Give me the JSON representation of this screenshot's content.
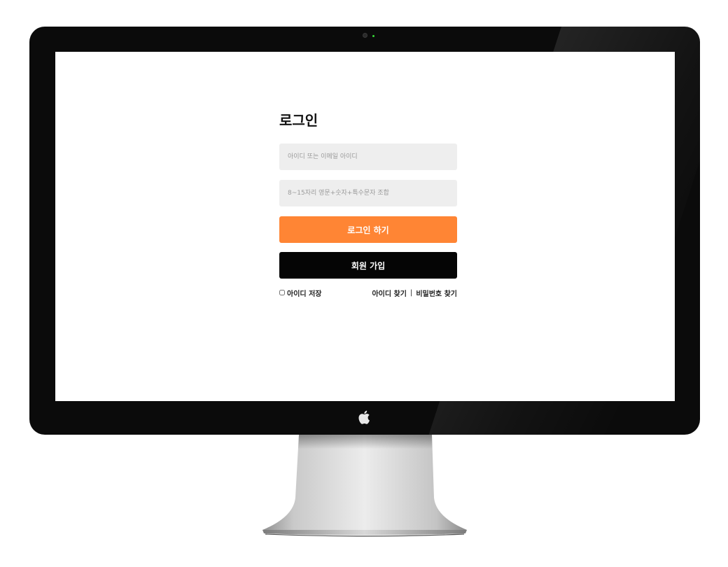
{
  "login": {
    "title": "로그인",
    "id_placeholder": "아이디 또는 이메일 아이디",
    "password_placeholder": "8~15자리 영문+숫자+특수문자 조합",
    "login_button": "로그인 하기",
    "signup_button": "회원 가입",
    "remember_label": "아이디 저장",
    "find_id_link": "아이디 찾기",
    "separator": "|",
    "find_password_link": "비밀번호 찾기"
  },
  "colors": {
    "login_button": "#ff8534",
    "signup_button": "#050505",
    "input_background": "#eeeeee",
    "bezel": "#0b0b0b"
  },
  "icons": {
    "device_logo": "apple-logo-icon",
    "camera": "camera-icon"
  }
}
